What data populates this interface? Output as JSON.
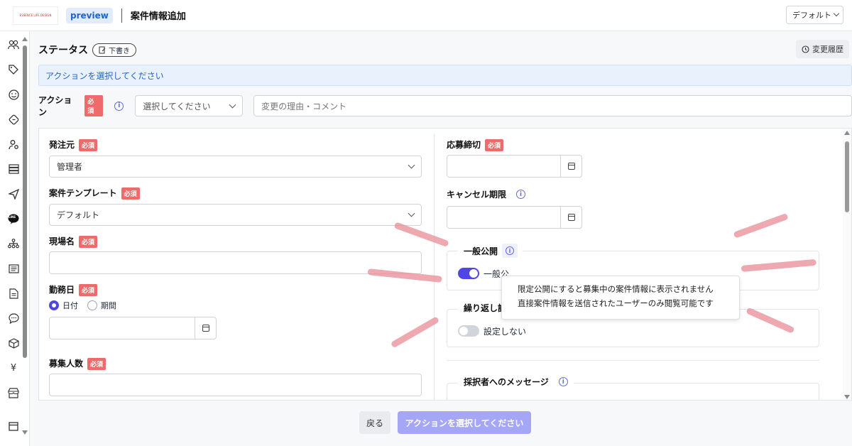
{
  "header": {
    "logo_text": "ESSENCE LIFE DESIGN",
    "preview_label": "preview",
    "page_title": "案件情報追加",
    "default_select": "デフォルト"
  },
  "sidebar": {
    "icons": [
      "users-icon",
      "tag-icon",
      "smile-icon",
      "ticket-icon",
      "user-settings-icon",
      "server-icon",
      "send-icon",
      "line-icon",
      "sitemap-icon",
      "list-icon",
      "document-icon",
      "chat-icon",
      "box-icon",
      "yen-icon",
      "store-icon",
      "calendar-icon"
    ],
    "line_badge": "LINE",
    "yen_glyph": "¥"
  },
  "status": {
    "title": "ステータス",
    "draft": "下書き",
    "history_button": "変更履歴",
    "alert": "アクションを選択してください"
  },
  "action": {
    "label": "アクション",
    "required": "必須",
    "select_placeholder": "選択してください",
    "comment_placeholder": "変更の理由・コメント"
  },
  "form": {
    "client_label": "発注元",
    "client_value": "管理者",
    "template_label": "案件テンプレート",
    "template_value": "デフォルト",
    "site_label": "現場名",
    "workday_label": "勤務日",
    "radio_date": "日付",
    "radio_period": "期間",
    "recruit_label": "募集人数",
    "deadline_label": "応募締切",
    "cancel_label": "キャンセル期限",
    "public_label": "一般公開",
    "public_toggle_text": "一般公",
    "repeat_label": "繰り返し設",
    "repeat_toggle_text": "設定しない",
    "message_label": "採択者へのメッセージ"
  },
  "tooltip": {
    "line1": "限定公開にすると募集中の案件情報に表示されません",
    "line2": "直接案件情報を送信されたユーザーのみ閲覧可能です"
  },
  "footer": {
    "back": "戻る",
    "submit": "アクションを選択してください"
  },
  "colors": {
    "accent": "#4f46e5",
    "required_badge": "#ef6b6b",
    "alert_bg": "#e8f1fc",
    "submit_disabled": "#a5a6f6"
  }
}
